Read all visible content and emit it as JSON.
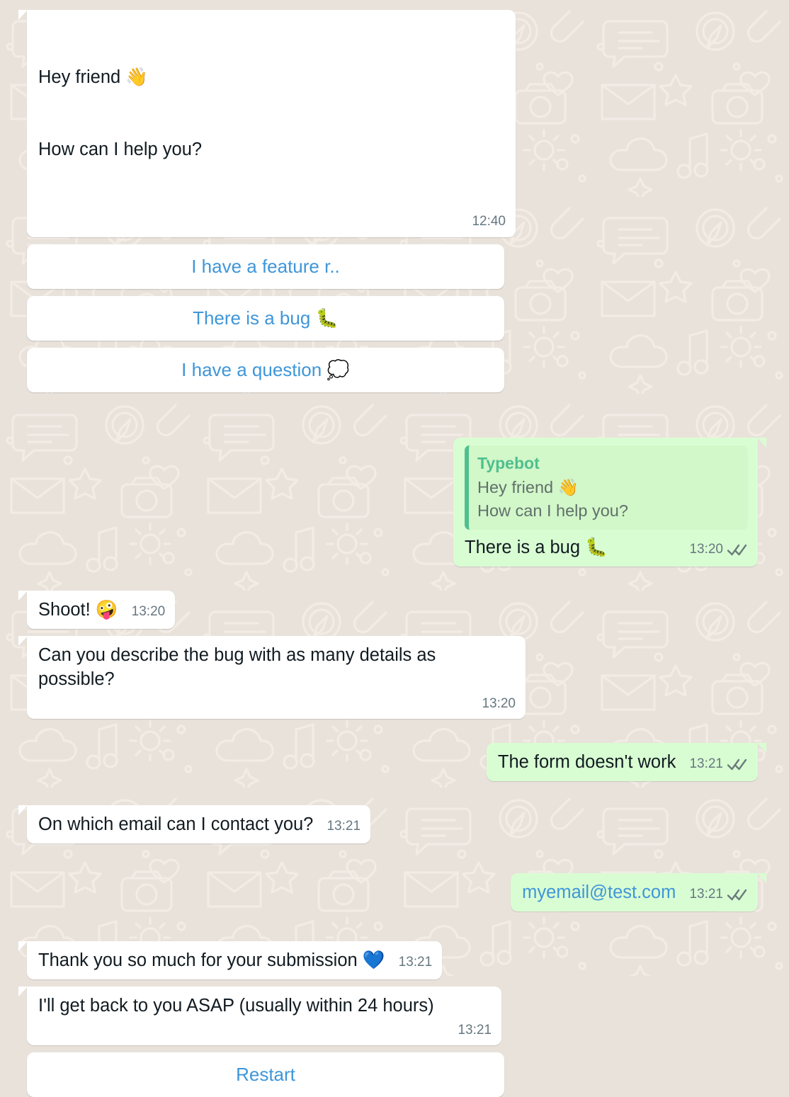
{
  "theme": {
    "background": "#e9e2db",
    "incoming_bubble": "#ffffff",
    "outgoing_bubble": "#d9fdd3",
    "quote_background": "#d2f7c9",
    "quote_accent": "#4fbf8f",
    "link_blue": "#3f96d9",
    "timestamp_gray": "#667781",
    "tick_color": "#6b7b7b",
    "text_color": "#111b21"
  },
  "messages": [
    {
      "id": "greeting",
      "direction": "incoming",
      "lines": [
        "Hey friend 👋",
        "How can I help you?"
      ],
      "time": "12:40",
      "ticks": false
    },
    {
      "id": "bug-reply",
      "direction": "outgoing",
      "quote": {
        "title": "Typebot",
        "lines": [
          "Hey friend 👋",
          "How can I help you?"
        ]
      },
      "lines": [
        "There is a bug 🐛"
      ],
      "time": "13:20",
      "ticks": true
    },
    {
      "id": "shoot",
      "direction": "incoming",
      "lines": [
        "Shoot! 🤪"
      ],
      "time": "13:20",
      "ticks": false
    },
    {
      "id": "describe-bug",
      "direction": "incoming",
      "lines": [
        "Can you describe the bug with as many details as possible?"
      ],
      "time": "13:20",
      "ticks": false
    },
    {
      "id": "form-doesnt-work",
      "direction": "outgoing",
      "lines": [
        "The form doesn't work"
      ],
      "time": "13:21",
      "ticks": true
    },
    {
      "id": "which-email",
      "direction": "incoming",
      "lines": [
        "On which email can I contact you?"
      ],
      "time": "13:21",
      "ticks": false
    },
    {
      "id": "email-answer",
      "direction": "outgoing",
      "lines": [
        "myemail@test.com"
      ],
      "is_link": true,
      "time": "13:21",
      "ticks": true
    },
    {
      "id": "thank-you",
      "direction": "incoming",
      "lines": [
        "Thank you so much for your submission 💙"
      ],
      "time": "13:21",
      "ticks": false
    },
    {
      "id": "get-back-asap",
      "direction": "incoming",
      "lines": [
        "I'll get back to you ASAP (usually within 24 hours)"
      ],
      "time": "13:21",
      "ticks": false
    }
  ],
  "option_buttons": [
    {
      "id": "feature-request",
      "label": "I have a feature r.."
    },
    {
      "id": "there-is-a-bug",
      "label": "There is a bug 🐛"
    },
    {
      "id": "i-have-a-question",
      "label": "I have a question 💭"
    }
  ],
  "restart_button": {
    "id": "restart",
    "label": "Restart"
  },
  "icons": {
    "double-check": "double-check-icon",
    "waving-hand": "waving-hand-emoji",
    "bug": "bug-emoji",
    "thought-balloon": "thought-balloon-emoji",
    "zany-face": "zany-face-emoji",
    "blue-heart": "blue-heart-emoji"
  }
}
